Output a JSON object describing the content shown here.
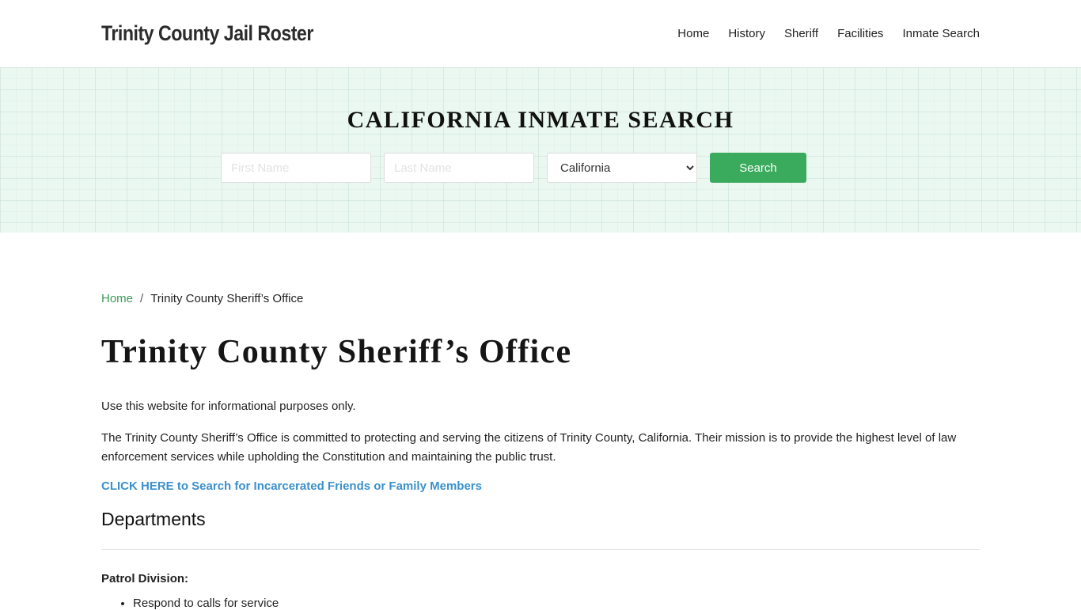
{
  "header": {
    "brand": "Trinity County Jail Roster",
    "nav": [
      "Home",
      "History",
      "Sheriff",
      "Facilities",
      "Inmate Search"
    ]
  },
  "hero": {
    "title": "CALIFORNIA INMATE SEARCH",
    "first_name_placeholder": "First Name",
    "last_name_placeholder": "Last Name",
    "state_selected": "California",
    "search_label": "Search",
    "accent_color": "#3aaa5c"
  },
  "breadcrumb": {
    "home": "Home",
    "separator": "/",
    "current": "Trinity County Sheriff’s Office"
  },
  "main": {
    "title": "Trinity County Sheriff’s Office",
    "intro": "Use this website for informational purposes only.",
    "description": "The Trinity County Sheriff’s Office is committed to protecting and serving the citizens of Trinity County, California. Their mission is to provide the highest level of law enforcement services while upholding the Constitution and maintaining the public trust.",
    "cta_link": "CLICK HERE to Search for Incarcerated Friends or Family Members",
    "departments_heading": "Departments",
    "patrol_heading": "Patrol Division:",
    "patrol_items": [
      "Respond to calls for service"
    ]
  }
}
